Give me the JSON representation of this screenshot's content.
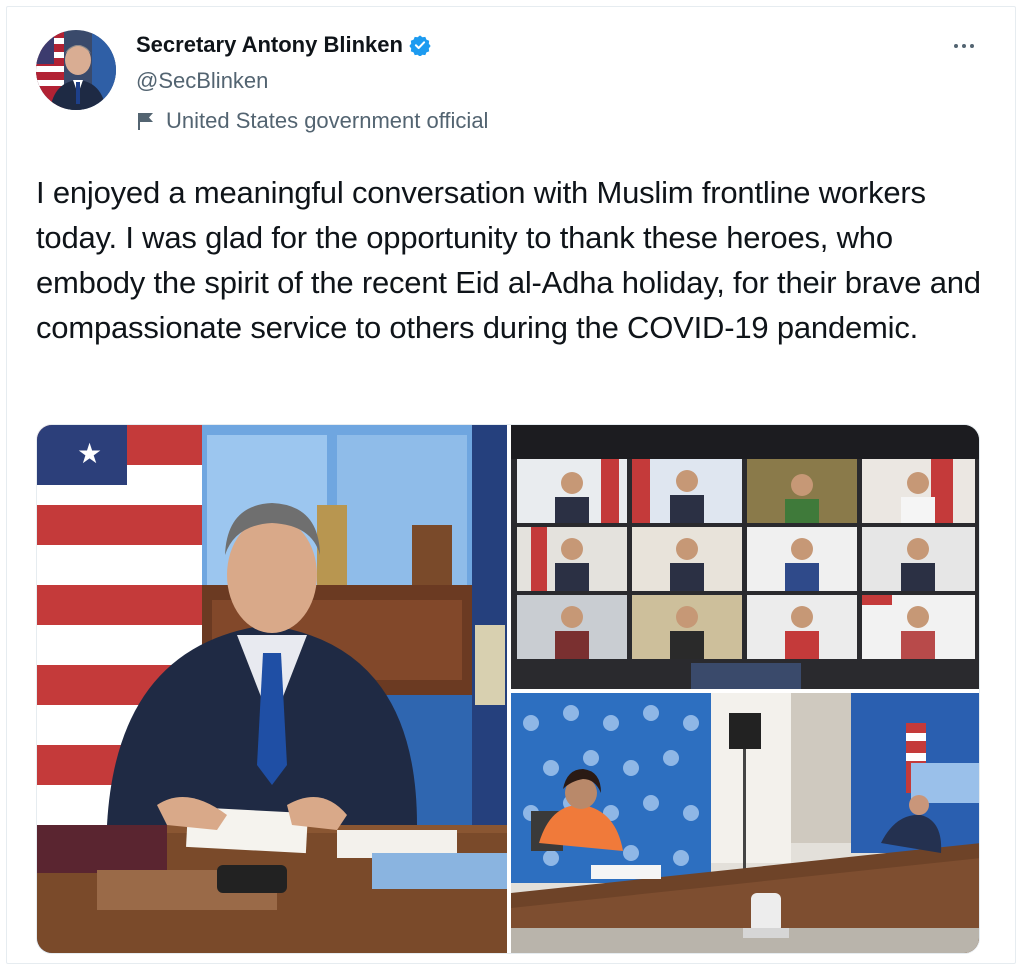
{
  "tweet": {
    "author": {
      "display_name": "Secretary Antony Blinken",
      "handle": "@SecBlinken",
      "label": "United States government official",
      "verified": true
    },
    "text": "I enjoyed a meaningful conversation with Muslim frontline workers today. I was glad for the opportunity to thank these heroes, who embody the spirit of the recent Eid al-Adha holiday, for their brave and compassionate service to others during the COVID-19 pandemic.",
    "media": [
      {
        "kind": "photo",
        "subject": "Secretary seated at desk with flags"
      },
      {
        "kind": "photo",
        "subject": "Video conference grid of participants"
      },
      {
        "kind": "photo",
        "subject": "Conference room with video call"
      }
    ]
  },
  "icons": {
    "verified": "verified-badge-icon",
    "label": "flag-icon",
    "more": "more-icon"
  },
  "colors": {
    "verified_blue": "#1d9bf0",
    "secondary_text": "#536471",
    "primary_text": "#0f1419"
  }
}
